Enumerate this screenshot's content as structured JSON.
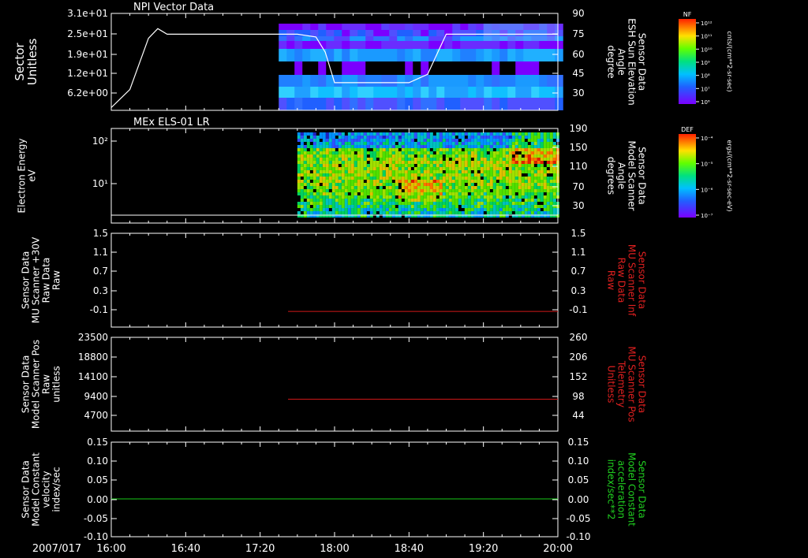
{
  "figure": {
    "date_label": "2007/017",
    "time_ticks": [
      "16:00",
      "16:40",
      "17:20",
      "18:00",
      "18:40",
      "19:20",
      "20:00"
    ]
  },
  "colors": {
    "background": "#000000",
    "axis": "#ffffff",
    "red_trace": "#d01818",
    "green_trace": "#18c818",
    "red_label": "#e02020",
    "green_label": "#20d020"
  },
  "colorbars": [
    {
      "id": "nf",
      "tag": "NF",
      "units": "cnts/(cm**2-sr-sec)",
      "ticks": [
        "10¹²",
        "10¹¹",
        "10¹⁰",
        "10⁹",
        "10⁸",
        "10⁷",
        "10⁶"
      ]
    },
    {
      "id": "def",
      "tag": "DEF",
      "units": "ergs/(cm**2-sr-sec-eV)",
      "ticks": [
        "10⁻⁴",
        "10⁻⁵",
        "10⁻⁶",
        "10⁻⁷"
      ]
    }
  ],
  "panels": [
    {
      "id": "npi",
      "title": "NPI Vector Data",
      "left_label": [
        "Sector",
        "Unitless"
      ],
      "left_ticks": [
        "3.1e+01",
        "2.5e+01",
        "1.9e+01",
        "1.2e+01",
        "6.2e+00"
      ],
      "right_label": [
        "Sensor Data",
        "ESH Sun Elevation",
        "Angle",
        "degree"
      ],
      "right_ticks": [
        "90",
        "75",
        "60",
        "45",
        "30"
      ]
    },
    {
      "id": "els",
      "title": "MEx ELS-01 LR",
      "left_label": [
        "Electron Energy",
        "eV"
      ],
      "left_ticks": [
        "10²",
        "10¹"
      ],
      "right_label": [
        "Sensor Data",
        "Model Scanner",
        "Angle",
        "degrees"
      ],
      "right_ticks": [
        "190",
        "150",
        "110",
        "70",
        "30"
      ]
    },
    {
      "id": "mu_raw",
      "title": "",
      "left_label": [
        "Sensor Data",
        "MU Scanner +30V",
        "Raw Data",
        "Raw"
      ],
      "left_ticks": [
        "1.5",
        "1.1",
        "0.7",
        "0.3",
        "-0.1"
      ],
      "right_label": [
        "Sensor Data",
        "MU Scanner Inf",
        "Raw Data",
        "Raw"
      ],
      "right_ticks": [
        "1.5",
        "1.1",
        "0.7",
        "0.3",
        "-0.1"
      ]
    },
    {
      "id": "scanner_pos",
      "title": "",
      "left_label": [
        "Sensor Data",
        "Model Scanner Pos",
        "Raw",
        "unitless"
      ],
      "left_ticks": [
        "23500",
        "18800",
        "14100",
        "9400",
        "4700"
      ],
      "right_label": [
        "Sensor Data",
        "MU Scanner Pos",
        "Telemetry",
        "Unitless"
      ],
      "right_ticks": [
        "260",
        "206",
        "152",
        "98",
        "44"
      ]
    },
    {
      "id": "constant",
      "title": "",
      "left_label": [
        "Sensor Data",
        "Model Constant",
        "velocity",
        "index/sec"
      ],
      "left_ticks": [
        "0.15",
        "0.10",
        "0.05",
        "0.00",
        "-0.05",
        "-0.10"
      ],
      "right_label": [
        "Sensor Data",
        "Model Constant",
        "acceleration",
        "index/sec**2"
      ],
      "right_ticks": [
        "0.15",
        "0.10",
        "0.05",
        "0.00",
        "-0.05",
        "-0.10"
      ]
    }
  ],
  "chart_data": [
    {
      "type": "line",
      "panel": "npi",
      "title": "NPI Vector Data",
      "xlabel": "",
      "ylabel": "degree",
      "ylim": [
        20,
        90
      ],
      "x": [
        "16:00",
        "16:10",
        "16:20",
        "16:25",
        "16:30",
        "16:40",
        "17:00",
        "17:20",
        "17:40",
        "17:50",
        "17:55",
        "18:00",
        "18:20",
        "18:40",
        "18:50",
        "19:00",
        "19:10",
        "20:00"
      ],
      "series": [
        {
          "name": "ESH Sun Elevation",
          "values": [
            22,
            35,
            72,
            79,
            75,
            75,
            75,
            75,
            75,
            73,
            62,
            40,
            40,
            40,
            46,
            75,
            75,
            75
          ]
        }
      ]
    },
    {
      "type": "heatmap",
      "panel": "els",
      "title": "MEx ELS-01 LR",
      "ylabel": "Electron Energy eV",
      "yscale": "log",
      "x_start": "17:40",
      "x_end": "20:00"
    },
    {
      "type": "line",
      "panel": "mu_raw",
      "ylim": [
        -0.3,
        1.5
      ],
      "x": [
        "17:35",
        "20:00"
      ],
      "series": [
        {
          "values": [
            0.0,
            0.0
          ]
        }
      ]
    },
    {
      "type": "line",
      "panel": "scanner_pos",
      "ylim": [
        0,
        23500
      ],
      "x": [
        "17:35",
        "20:00"
      ],
      "series": [
        {
          "values": [
            8000,
            8000
          ]
        }
      ]
    },
    {
      "type": "line",
      "panel": "constant",
      "ylim": [
        -0.1,
        0.15
      ],
      "x": [
        "16:00",
        "20:00"
      ],
      "series": [
        {
          "values": [
            0.0,
            0.0
          ]
        }
      ]
    }
  ]
}
